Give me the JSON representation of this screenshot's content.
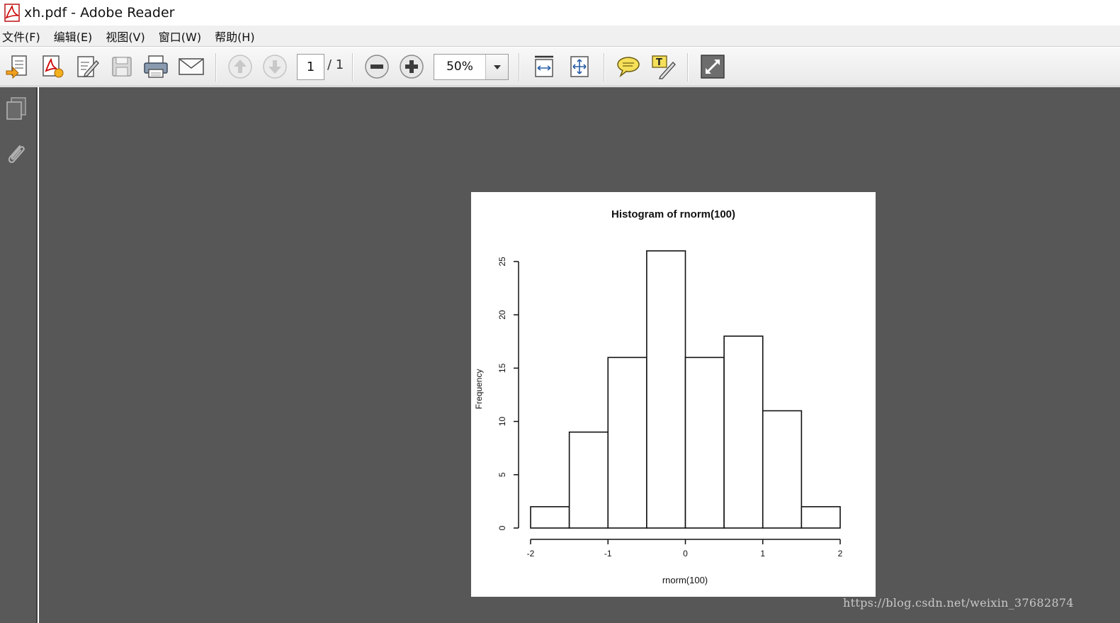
{
  "window": {
    "title": "xh.pdf - Adobe Reader"
  },
  "menu": [
    {
      "label": "文件(F)"
    },
    {
      "label": "编辑(E)"
    },
    {
      "label": "视图(V)"
    },
    {
      "label": "窗口(W)"
    },
    {
      "label": "帮助(H)"
    }
  ],
  "toolbar": {
    "current_page": "1",
    "page_total": "/ 1",
    "zoom": "50%",
    "icons": [
      "open-icon",
      "create-pdf-icon",
      "edit-icon",
      "save-icon",
      "print-icon",
      "email-icon",
      "previous-page-icon",
      "next-page-icon",
      "zoom-out-icon",
      "zoom-in-icon",
      "fit-width-icon",
      "fit-page-icon",
      "comment-icon",
      "highlight-icon",
      "full-screen-icon"
    ]
  },
  "sidepanel": {
    "icons": [
      "pages-icon",
      "attachment-icon"
    ]
  },
  "watermark": "https://blog.csdn.net/weixin_37682874",
  "colors": {
    "doc_background": "#575757",
    "side_panel": "#595959",
    "page": "#ffffff"
  },
  "chart_data": {
    "type": "bar",
    "title": "Histogram of rnorm(100)",
    "xlabel": "rnorm(100)",
    "ylabel": "Frequency",
    "bins": [
      {
        "start": -2.0,
        "end": -1.5,
        "count": 2
      },
      {
        "start": -1.5,
        "end": -1.0,
        "count": 9
      },
      {
        "start": -1.0,
        "end": -0.5,
        "count": 16
      },
      {
        "start": -0.5,
        "end": 0.0,
        "count": 26
      },
      {
        "start": 0.0,
        "end": 0.5,
        "count": 16
      },
      {
        "start": 0.5,
        "end": 1.0,
        "count": 18
      },
      {
        "start": 1.0,
        "end": 1.5,
        "count": 11
      },
      {
        "start": 1.5,
        "end": 2.0,
        "count": 2
      }
    ],
    "xticks": [
      -2,
      -1,
      0,
      1,
      2
    ],
    "xtick_labels": [
      "-2",
      "-1",
      "0",
      "1",
      "2"
    ],
    "yticks": [
      0,
      5,
      10,
      15,
      20,
      25
    ],
    "ytick_labels": [
      "0",
      "5",
      "10",
      "15",
      "20",
      "25"
    ],
    "xlim": [
      -2,
      2
    ],
    "ylim": [
      0,
      25
    ],
    "grid": false
  }
}
